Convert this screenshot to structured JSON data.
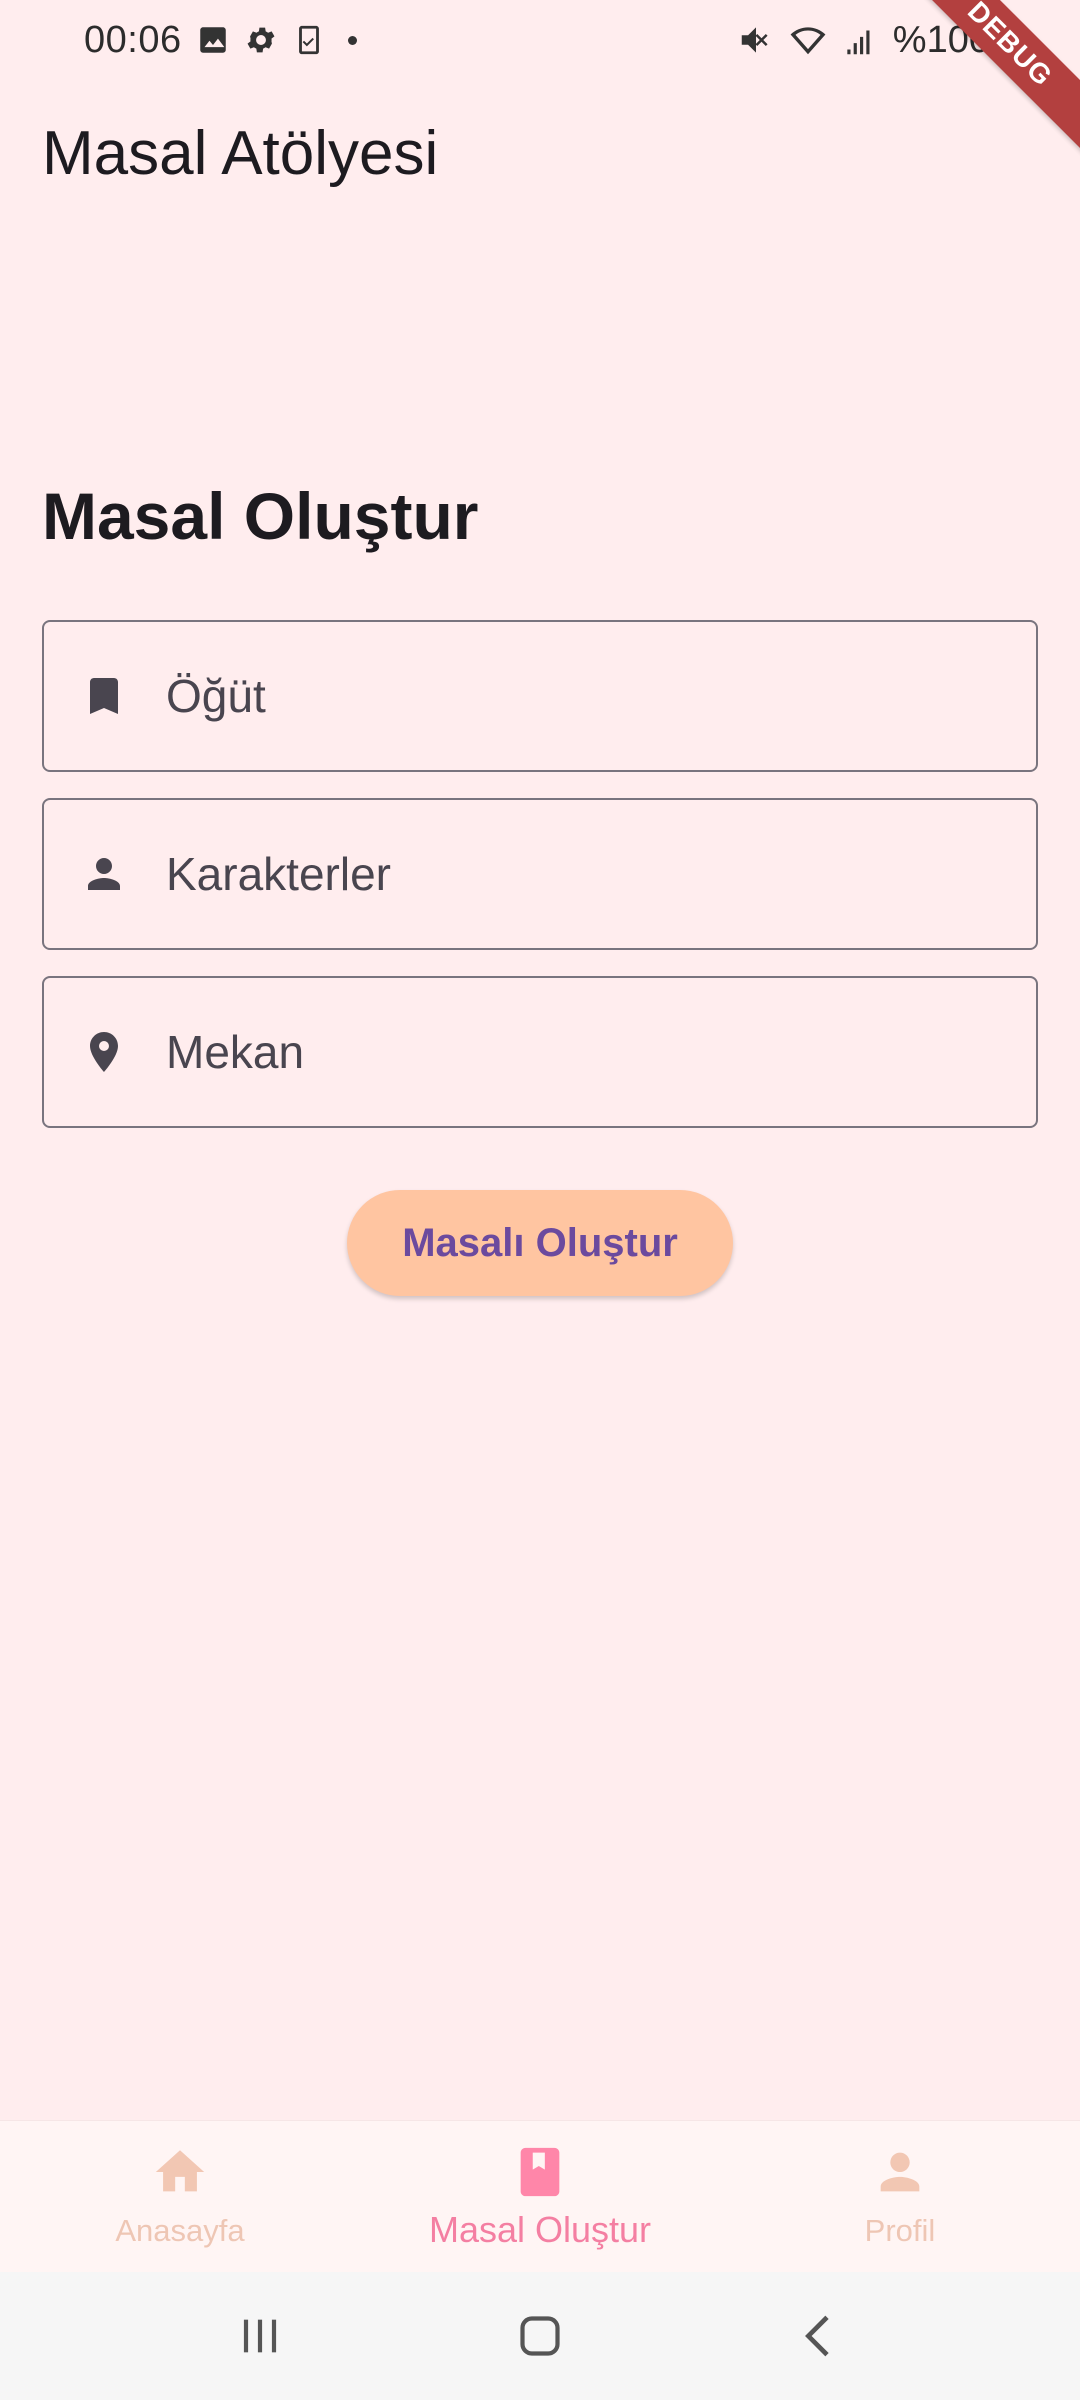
{
  "status_bar": {
    "time": "00:06",
    "battery_text": "%100"
  },
  "debug_ribbon": {
    "label": "DEBUG"
  },
  "app_bar": {
    "title": "Masal Atölyesi"
  },
  "page": {
    "heading": "Masal Oluştur"
  },
  "form": {
    "fields": [
      {
        "icon": "bookmark-icon",
        "placeholder": "Öğüt",
        "value": ""
      },
      {
        "icon": "person-icon",
        "placeholder": "Karakterler",
        "value": ""
      },
      {
        "icon": "location-pin-icon",
        "placeholder": "Mekan",
        "value": ""
      }
    ],
    "submit_label": "Masalı Oluştur"
  },
  "bottom_nav": {
    "items": [
      {
        "label": "Anasayfa",
        "icon": "home-icon",
        "active": false
      },
      {
        "label": "Masal Oluştur",
        "icon": "book-icon",
        "active": true
      },
      {
        "label": "Profil",
        "icon": "person-icon",
        "active": false
      }
    ]
  },
  "colors": {
    "background": "#FFEDEE",
    "button_bg": "#FFC5A1",
    "button_text": "#6B4A9E",
    "nav_active": "#F47FA2",
    "nav_inactive": "#EEC6B4",
    "debug_ribbon": "#B3403F"
  }
}
